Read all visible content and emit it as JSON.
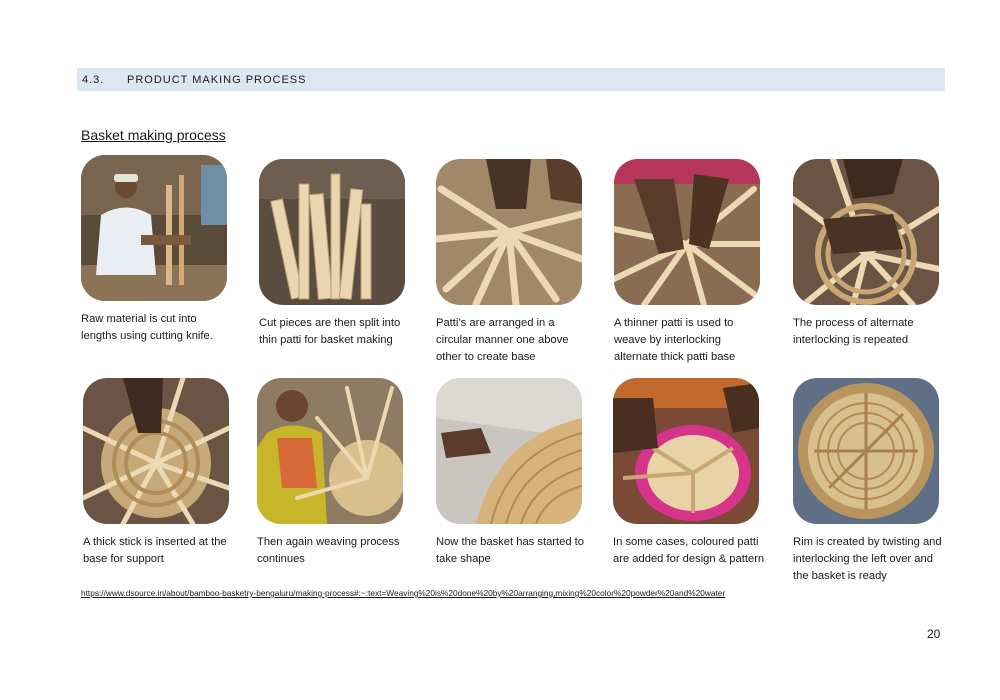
{
  "section": {
    "number": "4.3.",
    "title": "PRODUCT MAKING PROCESS"
  },
  "subtitle": "Basket making process",
  "steps": [
    {
      "caption": "Raw material is cut into\nlengths using cutting knife."
    },
    {
      "caption": "Cut pieces are then split into\nthin patti for basket making"
    },
    {
      "caption": "Patti’s are arranged in a\ncircular manner one above\nother to create base"
    },
    {
      "caption": "A thinner patti is used to\nweave by interlocking\nalternate thick patti base"
    },
    {
      "caption": "The process of alternate\ninterlocking is repeated"
    },
    {
      "caption": "A thick stick is inserted at the\nbase for support"
    },
    {
      "caption": "Then again weaving process\ncontinues"
    },
    {
      "caption": "Now the basket has started to\ntake shape"
    },
    {
      "caption": "In some cases, coloured patti\nare added for design & pattern"
    },
    {
      "caption": "Rim is created by twisting and\ninterlocking the left over and\nthe basket is ready"
    }
  ],
  "source_url": "https://www.dsource.in/about/bamboo-basketry-bengaluru/making-process#:~:text=Weaving%20is%20done%20by%20arranging,mixing%20color%20powder%20and%20water",
  "page_number": "20",
  "colors": {
    "header_band": "#dde7f1",
    "bamboo": "#d9b98a",
    "pink_patti": "#d6338a"
  }
}
